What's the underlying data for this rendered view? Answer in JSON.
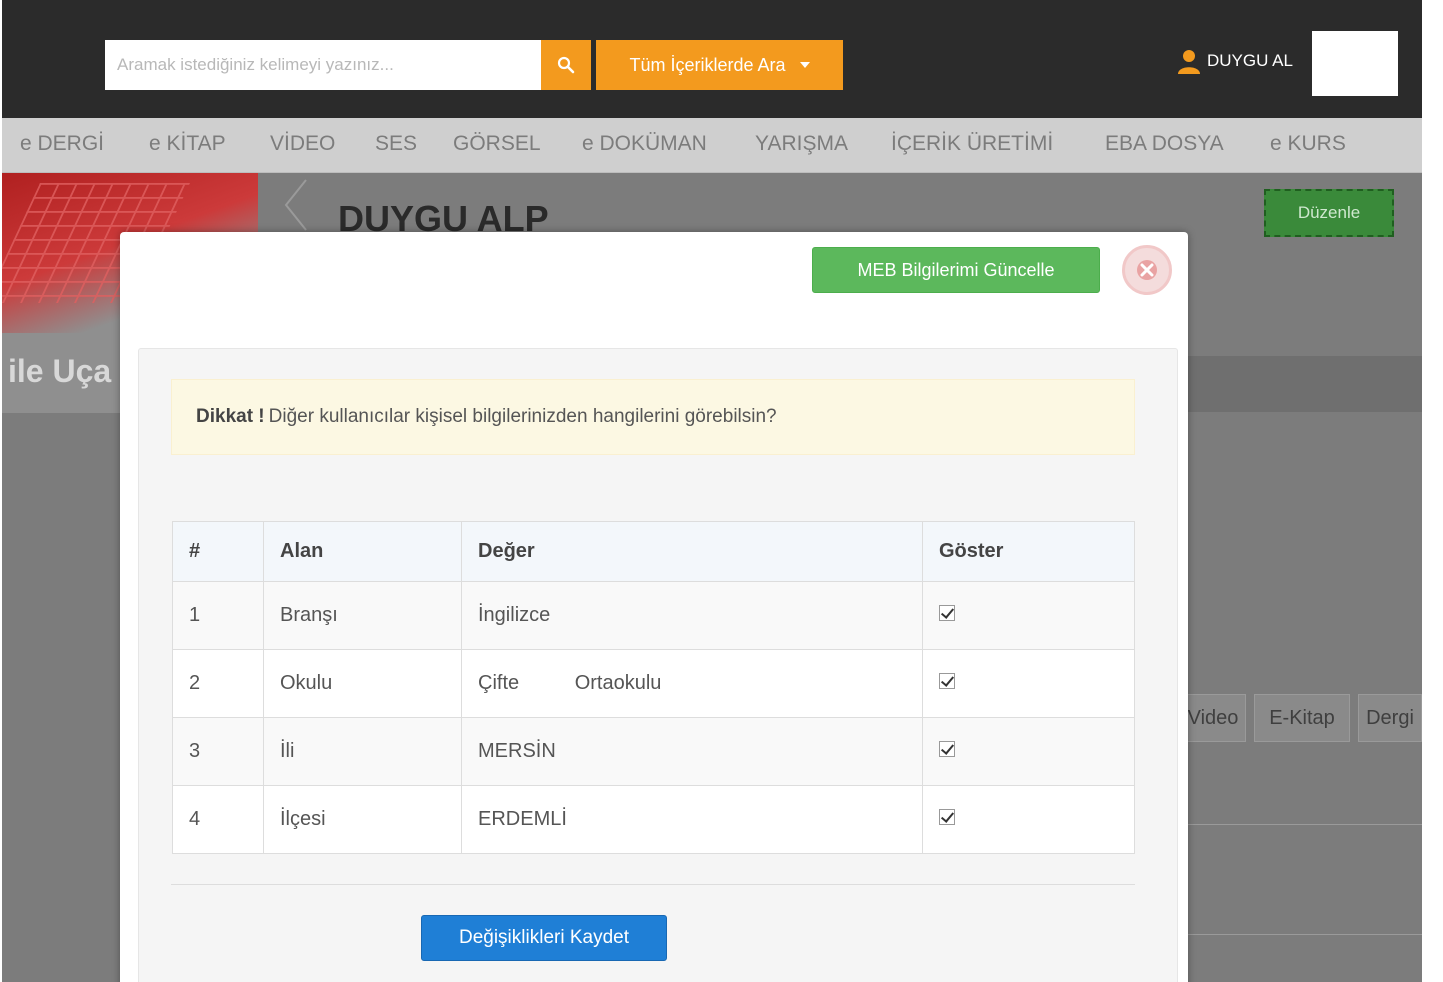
{
  "header": {
    "search_placeholder": "Aramak istediğiniz kelimeyi yazınız...",
    "scope_label": "Tüm İçeriklerde Ara",
    "user_name": "DUYGU AL"
  },
  "nav": {
    "items": [
      "e DERGİ",
      "e KİTAP",
      "VİDEO",
      "SES",
      "GÖRSEL",
      "e DOKÜMAN",
      "YARIŞMA",
      "İÇERİK ÜRETİMİ",
      "EBA DOSYA",
      "e KURS"
    ]
  },
  "background": {
    "banner_text": "ile Uça",
    "profile_name": "DUYGU ALP",
    "edit_label": "Düzenle",
    "tabs": [
      "Video",
      "E-Kitap",
      "Dergi"
    ]
  },
  "modal": {
    "meb_button": "MEB Bilgilerimi Güncelle",
    "alert_strong": "Dikkat !",
    "alert_text": "Diğer kullanıcılar kişisel bilgilerinizden hangilerini görebilsin?",
    "table": {
      "headers": [
        "#",
        "Alan",
        "Değer",
        "Göster"
      ],
      "rows": [
        {
          "num": "1",
          "field": "Branşı",
          "value": "İngilizce",
          "show": true
        },
        {
          "num": "2",
          "field": "Okulu",
          "value": "Çifte          Ortaokulu",
          "show": true
        },
        {
          "num": "3",
          "field": "İli",
          "value": "MERSİN",
          "show": true
        },
        {
          "num": "4",
          "field": "İlçesi",
          "value": "ERDEMLİ",
          "show": true
        }
      ]
    },
    "save_button": "Değişiklikleri Kaydet"
  },
  "colors": {
    "topbar": "#2b2b2b",
    "accent_orange": "#f39a1e",
    "green_button": "#5cb85c",
    "blue_button": "#1f7fd6",
    "alert_bg": "#fcf8e3"
  }
}
